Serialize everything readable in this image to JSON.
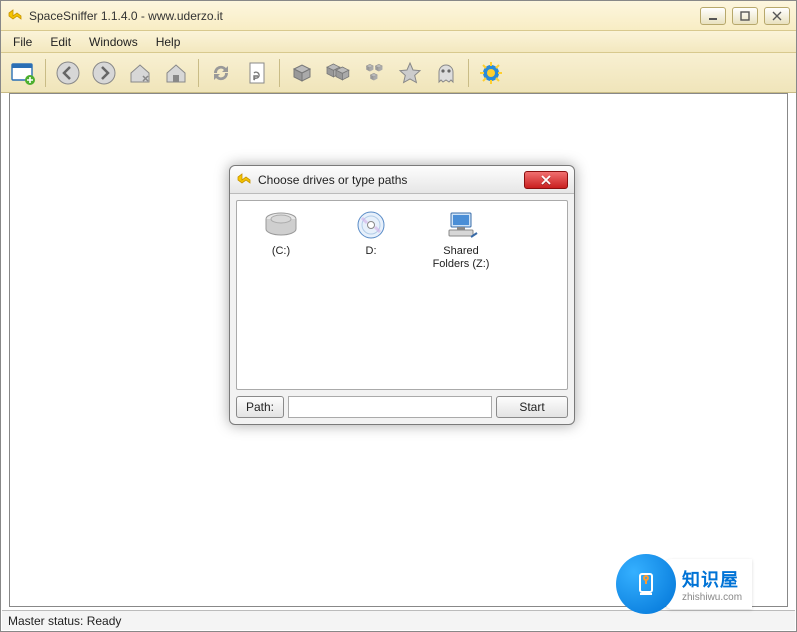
{
  "title": "SpaceSniffer 1.1.4.0 - www.uderzo.it",
  "menu": {
    "file": "File",
    "edit": "Edit",
    "windows": "Windows",
    "help": "Help"
  },
  "toolbar_icons": {
    "new": "new-window",
    "back": "back",
    "forward": "forward",
    "home_open": "home-open",
    "home": "home",
    "refresh": "refresh",
    "reload_doc": "reload-doc",
    "box1": "box-single",
    "box2": "box-double",
    "boxes": "box-stack",
    "star": "star",
    "ghost": "ghost",
    "gear": "gear"
  },
  "status": "Master status: Ready",
  "dialog": {
    "title": "Choose drives or type paths",
    "drives": [
      {
        "label": "(C:)",
        "kind": "hdd"
      },
      {
        "label": "D:",
        "kind": "cd"
      },
      {
        "label": "Shared\nFolders (Z:)",
        "kind": "net"
      }
    ],
    "path_label": "Path:",
    "path_value": "",
    "start_label": "Start"
  },
  "watermark": {
    "brand": "知识屋",
    "site": "zhishiwu.com"
  }
}
